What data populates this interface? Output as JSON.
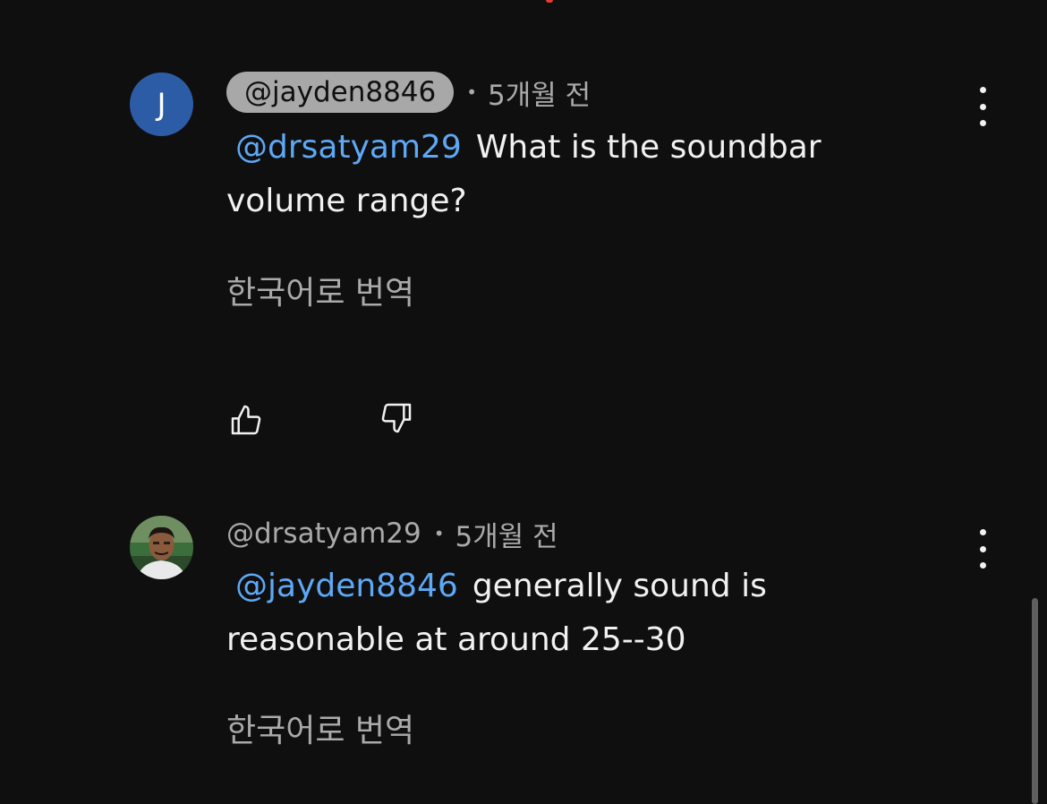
{
  "comments": [
    {
      "avatar_letter": "J",
      "avatar_color": "#2d5ca6",
      "handle": "@jayden8846",
      "separator": "•",
      "time": "5개월 전",
      "mention": "@drsatyam29",
      "text": "What is the soundbar volume range?",
      "translate_label": "한국어로 번역",
      "icons": [
        "thumbs-up-icon",
        "thumbs-down-icon",
        "more-vert-icon"
      ]
    },
    {
      "avatar_type": "photo",
      "handle": "@drsatyam29",
      "separator": "•",
      "time": "5개월 전",
      "mention": "@jayden8846",
      "text": "generally sound is reasonable at around 25--30",
      "translate_label": "한국어로 번역",
      "icons": [
        "more-vert-icon"
      ]
    }
  ],
  "colors": {
    "background": "#0f0f0f",
    "mention": "#5ea8f5",
    "secondary_text": "#aaaaaa"
  }
}
